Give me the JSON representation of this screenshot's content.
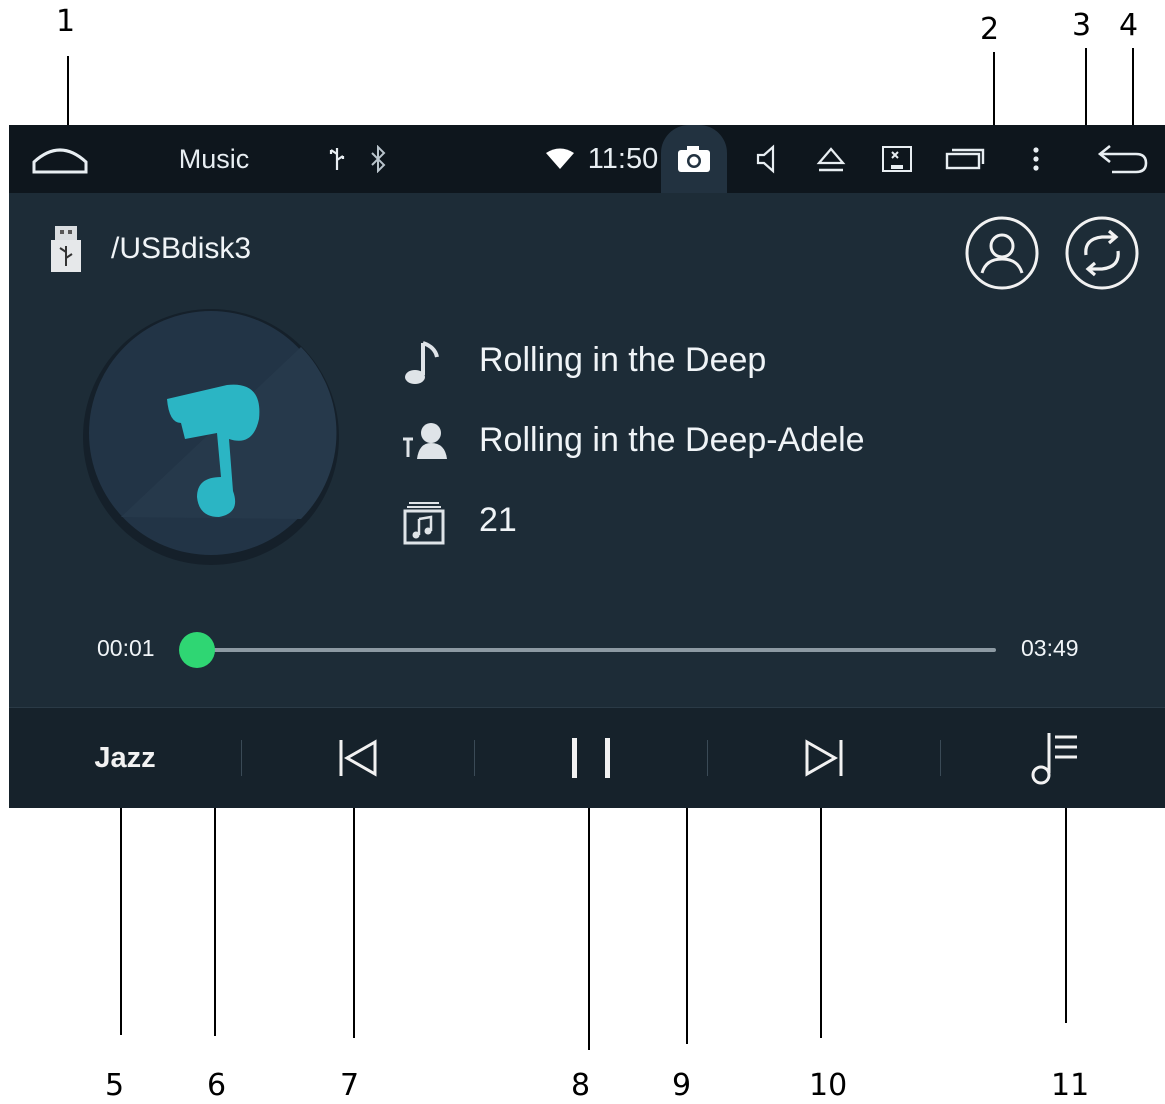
{
  "callouts": [
    "1",
    "2",
    "3",
    "4",
    "5",
    "6",
    "7",
    "8",
    "9",
    "10",
    "11"
  ],
  "statusbar": {
    "app_title": "Music",
    "time": "11:50",
    "icons": [
      "home-icon",
      "usb-icon",
      "bluetooth-icon",
      "wifi-icon",
      "camera-icon",
      "volume-icon",
      "eject-icon",
      "screen-off-icon",
      "recent-apps-icon",
      "more-icon",
      "back-icon"
    ]
  },
  "source": {
    "path": "/USBdisk3",
    "icon": "usb-drive-icon"
  },
  "top_actions": {
    "artist_icon": "person-icon",
    "repeat_icon": "repeat-icon"
  },
  "track": {
    "title": "Rolling in the Deep",
    "artist": "Rolling in the Deep-Adele",
    "album": "21"
  },
  "progress": {
    "elapsed": "00:01",
    "total": "03:49",
    "fraction": 0.004
  },
  "controls": {
    "eq_label": "Jazz",
    "icons": [
      "previous-icon",
      "pause-icon",
      "next-icon",
      "playlist-icon"
    ]
  },
  "colors": {
    "accent_green": "#2fd673",
    "album_teal": "#2bb5c4"
  }
}
